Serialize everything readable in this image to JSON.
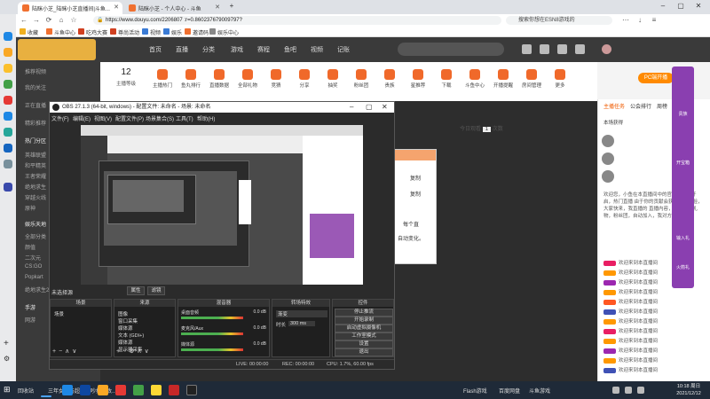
{
  "browser": {
    "tabs": [
      {
        "label": "陆眯小芝_陆眯小芝直播间|斗鱼..."
      },
      {
        "label": "陆眯小芝 - 个人中心 - 斗鱼"
      }
    ],
    "new_tab": "+",
    "url": "https://www.douyu.com/2206807 :r=0.860237679009797?",
    "search": "搜索你想在ESN8游戏的",
    "bookmarks": [
      "收藏",
      "斗鱼中心",
      "吃鸡大赛",
      "尊尚活动",
      "视频",
      "娱乐",
      "邀请码",
      "娱乐中心"
    ]
  },
  "site": {
    "nav": [
      "首页",
      "直播",
      "分类",
      "游戏",
      "赛程",
      "鱼吧",
      "视频",
      "记账"
    ],
    "sidenav": [
      "推荐视频",
      "我的关注",
      "正在直播",
      "精彩推荐",
      "热门分区",
      "英雄联盟",
      "和平精英",
      "王者荣耀",
      "绝地求生",
      "穿越火线",
      "原神",
      "娱乐天地",
      "全部分类",
      "颜值",
      "二次元",
      "CS:GO",
      "Popkart",
      "绝地求生2",
      "手游",
      "网游"
    ],
    "room_toolbar": {
      "level_num": "12",
      "level_label": "主播等级",
      "items": [
        "主播热门",
        "鱼丸排行",
        "直播数据",
        "全部礼物",
        "竞猜",
        "分享",
        "抽奖",
        "粉丝团",
        "贵族",
        "星推荐",
        "下载",
        "斗鱼中心",
        "开播提醒",
        "房间管理",
        "更多"
      ],
      "pc_button": "PC端开播"
    },
    "today_rank": "今日观看",
    "today_rank_value": "1",
    "today_rank_suffix": "次数",
    "dialog_lines": [
      "复制",
      "复制",
      "每个直",
      "自动变化。"
    ]
  },
  "chat": {
    "tabs": [
      "主播任务",
      "公会排行",
      "周榜",
      "贵族"
    ],
    "notice_lines": [
      "本场获得",
      "欢迎您，小鱼在本直播间中的官方红包已开启，热门直播 由于你的贡献会获得额外经验，大家快来，我直播的 直播内容，可以抽取礼物，粉丝团，自动加入，我对方的..."
    ],
    "messages": [
      "欢迎来到本直播间",
      "欢迎来到本直播间",
      "欢迎来到本直播间",
      "欢迎来到本直播间",
      "欢迎来到本直播间",
      "欢迎来到本直播间",
      "欢迎来到本直播间",
      "欢迎来到本直播间",
      "欢迎来到本直播间",
      "欢迎来到本直播间",
      "欢迎来到本直播间",
      "欢迎来到本直播间"
    ],
    "promo": [
      "贵族",
      "开宝箱",
      "输入礼",
      "火箭礼"
    ]
  },
  "obs": {
    "title": "OBS 27.1.3 (64-bit, windows) - 配置文件: 未命名 - 场景: 未命名",
    "menu": [
      "文件(F)",
      "编辑(E)",
      "视图(V)",
      "配置文件(P)",
      "场景集合(S)",
      "工具(T)",
      "帮助(H)"
    ],
    "scenes_label": "未选择源",
    "studio_buttons": [
      "属性",
      "滤镜"
    ],
    "docks": {
      "scenes": {
        "title": "场景",
        "items": [
          "场景"
        ]
      },
      "sources": {
        "title": "来源",
        "items": [
          "图像",
          "窗口采集",
          "媒体源",
          "文本 (GDI+)",
          "媒体源",
          "显示器采集"
        ]
      },
      "mixer": {
        "title": "混音器",
        "rows": [
          {
            "name": "桌面音频",
            "db": "0.0 dB"
          },
          {
            "name": "麦克风/Aux",
            "db": "0.0 dB"
          },
          {
            "name": "媒体源",
            "db": "0.0 dB"
          }
        ]
      },
      "transitions": {
        "title": "转场特效",
        "type": "渐变",
        "duration_label": "时长",
        "duration": "300 ms"
      },
      "controls": {
        "title": "控件",
        "buttons": [
          "停止推流",
          "开始录制",
          "启动虚拟摄像机",
          "工作室模式",
          "设置",
          "退出"
        ]
      }
    },
    "status": {
      "live": "LIVE: 00:00:00",
      "rec": "REC: 00:00:00",
      "cpu": "CPU: 1.7%, 60.00 fps"
    }
  },
  "taskbar": {
    "items": [
      "回收站",
      "三年女子与超人争吵打架致..."
    ],
    "tray": [
      "Flash游戏",
      "百度网盘",
      "斗鱼游戏"
    ],
    "time": "10:18 周日",
    "date": "2021/12/12"
  }
}
